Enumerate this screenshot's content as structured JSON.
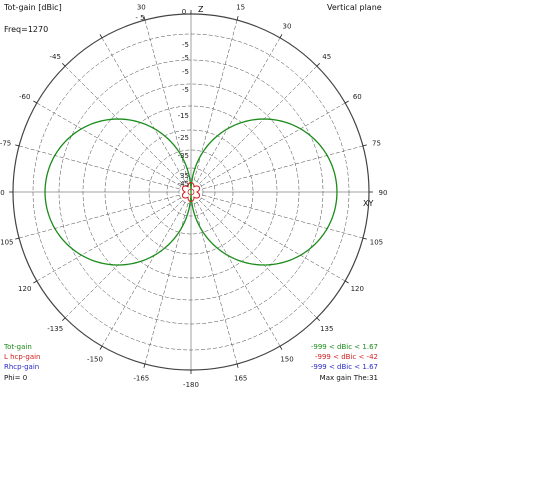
{
  "header": {
    "title": "Tot-gain [dBic]",
    "plane": "Vertical plane",
    "freq": "Freq=1270",
    "angle_top": "0",
    "angle_top_left": "- 5"
  },
  "colors": {
    "total": "#1a8c1a",
    "lhcp": "#d42020",
    "rhcp": "#2a2ac8",
    "grid": "#444444",
    "text": "#111111"
  },
  "angle_labels": [
    "-180",
    "-165",
    "-150",
    "-135",
    "-120",
    "-105",
    "-90",
    "-75",
    "-60",
    "-45",
    "30",
    "15",
    "30",
    "45",
    "60",
    "75",
    "90",
    "105",
    "120",
    "135",
    "150",
    "165",
    "180"
  ],
  "xy_label": "XY",
  "ring_labels": [
    "-5",
    "-15",
    "-25",
    "-35",
    "-45",
    "35"
  ],
  "legend": {
    "left": [
      {
        "label": "Tot-gain",
        "color": "#1a8c1a"
      },
      {
        "label": "L hcp-gain",
        "color": "#d42020"
      },
      {
        "label": "Rhcp-gain",
        "color": "#2a2ac8"
      },
      {
        "label": "Phi= 0",
        "color": "#111111"
      }
    ],
    "right": [
      {
        "label": "-999 < dBic < 1.67",
        "color": "#1a8c1a"
      },
      {
        "label": "-999 < dBic < -42",
        "color": "#d42020"
      },
      {
        "label": "-999 < dBic < 1.67",
        "color": "#2a2ac8"
      },
      {
        "label": "Max gain The:31",
        "color": "#111111"
      }
    ]
  },
  "chart_data": {
    "type": "polar",
    "plane": "Vertical plane",
    "phi": 0,
    "series": [
      {
        "name": "Tot-gain",
        "range": "-999 < dBic < 1.67",
        "pattern": "sin(theta) doublet lobes"
      },
      {
        "name": "L hcp-gain",
        "range": "-999 < dBic < -42",
        "pattern": "small center flower"
      },
      {
        "name": "Rhcp-gain",
        "range": "-999 < dBic < 1.67"
      }
    ],
    "max_gain_theta": 31,
    "angle_step_deg": 15
  }
}
